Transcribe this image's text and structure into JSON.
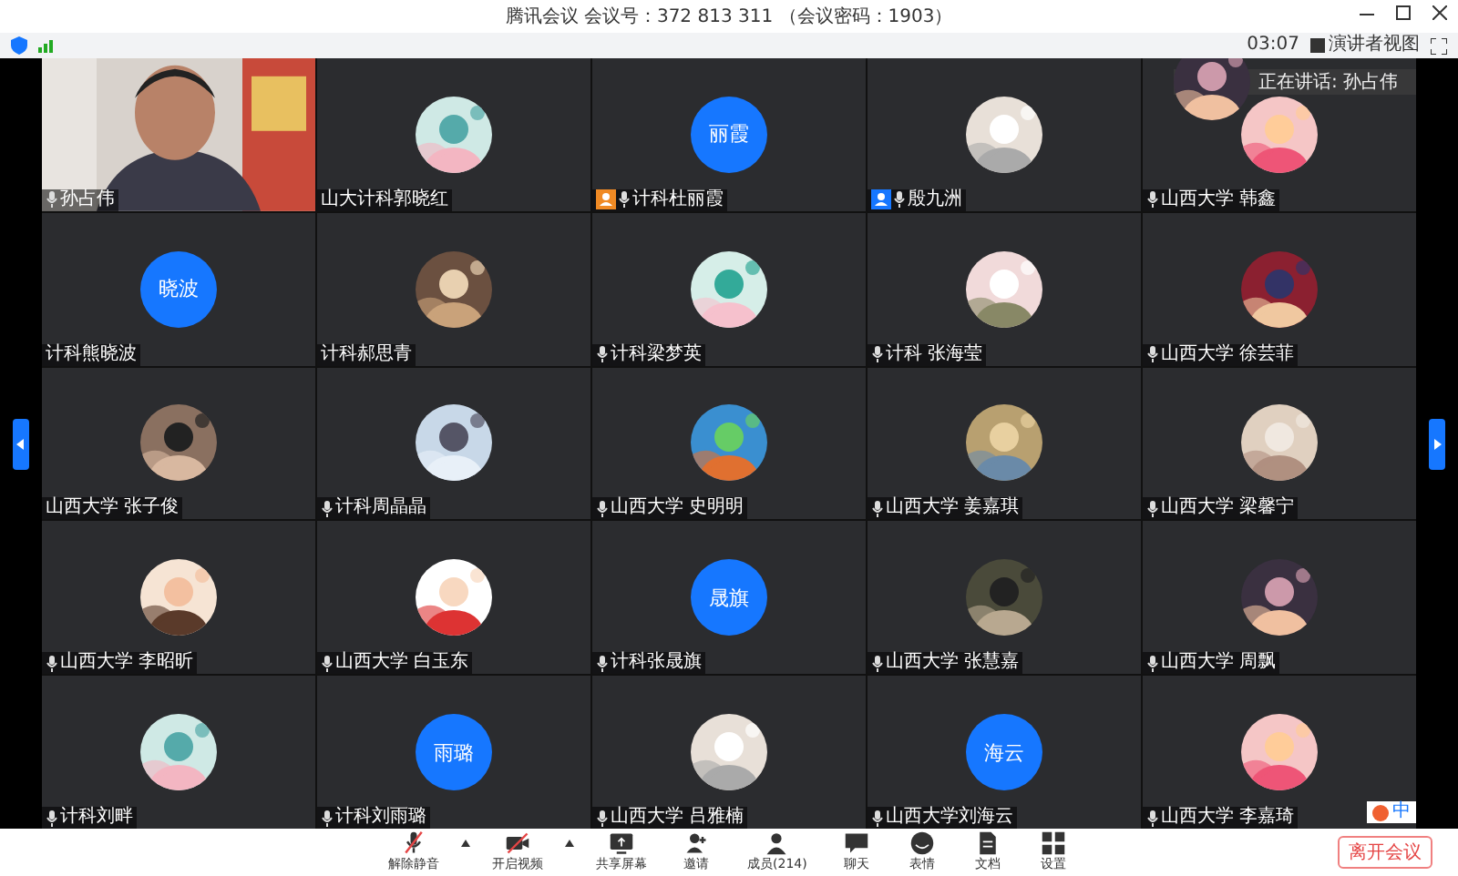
{
  "window": {
    "title": "腾讯会议 会议号：372 813 311 （会议密码：1903）"
  },
  "status_bar": {
    "time": "03:07",
    "view_button": "演讲者视图"
  },
  "speaking": {
    "label": "正在讲话: 孙占伟"
  },
  "tiles": [
    {
      "kind": "video",
      "name": "孙占伟",
      "mic": true
    },
    {
      "kind": "picture",
      "name": "山大计科郭晓红",
      "mic": false
    },
    {
      "kind": "initials",
      "initials": "丽霞",
      "name": "计科杜丽霞",
      "mic": true,
      "color": "#f08a24"
    },
    {
      "kind": "picture",
      "name": "殷九洲",
      "mic": true,
      "color": "#1677ff"
    },
    {
      "kind": "picture",
      "name": "山西大学 韩鑫",
      "mic": true
    },
    {
      "kind": "initials",
      "initials": "晓波",
      "name": "计科熊晓波",
      "mic": false
    },
    {
      "kind": "picture",
      "name": "计科郝思青",
      "mic": false
    },
    {
      "kind": "picture",
      "name": "计科梁梦英",
      "mic": true
    },
    {
      "kind": "picture",
      "name": "计科 张海莹",
      "mic": true
    },
    {
      "kind": "picture",
      "name": "山西大学 徐芸菲",
      "mic": true
    },
    {
      "kind": "picture",
      "name": "山西大学 张子俊",
      "mic": false
    },
    {
      "kind": "picture",
      "name": "计科周晶晶",
      "mic": true
    },
    {
      "kind": "picture",
      "name": "山西大学 史明明",
      "mic": true
    },
    {
      "kind": "picture",
      "name": "山西大学 姜嘉琪",
      "mic": true
    },
    {
      "kind": "picture",
      "name": "山西大学 梁馨宁",
      "mic": true
    },
    {
      "kind": "picture",
      "name": "山西大学 李昭昕",
      "mic": true
    },
    {
      "kind": "picture",
      "name": "山西大学 白玉东",
      "mic": true
    },
    {
      "kind": "initials",
      "initials": "晟旗",
      "name": "计科张晟旗",
      "mic": true
    },
    {
      "kind": "picture",
      "name": "山西大学 张慧嘉",
      "mic": true
    },
    {
      "kind": "picture",
      "name": "山西大学 周飘",
      "mic": true
    },
    {
      "kind": "picture",
      "name": "计科刘畔",
      "mic": true
    },
    {
      "kind": "initials",
      "initials": "雨璐",
      "name": "计科刘雨璐",
      "mic": true
    },
    {
      "kind": "picture",
      "name": "山西大学 吕雅楠",
      "mic": true
    },
    {
      "kind": "initials",
      "initials": "海云",
      "name": "山西大学刘海云",
      "mic": true
    },
    {
      "kind": "picture",
      "name": "山西大学 李嘉琦",
      "mic": true
    }
  ],
  "ime": {
    "label": "中"
  },
  "toolbar": [
    {
      "kind": "mic",
      "label": "解除静音",
      "caret": true
    },
    {
      "kind": "camera",
      "label": "开启视频",
      "caret": true
    },
    {
      "kind": "share",
      "label": "共享屏幕"
    },
    {
      "kind": "invite",
      "label": "邀请"
    },
    {
      "kind": "members",
      "label": "成员(214)"
    },
    {
      "kind": "chat",
      "label": "聊天"
    },
    {
      "kind": "emoji",
      "label": "表情"
    },
    {
      "kind": "doc",
      "label": "文档"
    },
    {
      "kind": "settings",
      "label": "设置"
    }
  ],
  "leave_button": "离开会议"
}
